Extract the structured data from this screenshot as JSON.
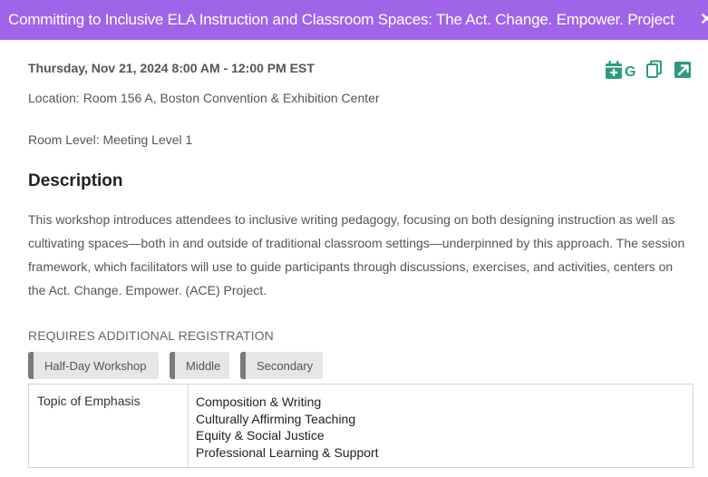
{
  "window": {
    "title": "Committing to Inclusive ELA Instruction and Classroom Spaces: The Act. Change. Empower. Project",
    "close_glyph": "✕"
  },
  "event": {
    "datetime": "Thursday, Nov 21, 2024 8:00 AM - 12:00 PM EST",
    "location": "Location: Room 156 A, Boston Convention & Exhibition Center",
    "room_level": "Room Level: Meeting Level 1"
  },
  "actions": {
    "icons": [
      "calendar-add-icon",
      "google-calendar-icon",
      "copy-icon",
      "external-link-icon"
    ],
    "accent_color": "#2e9a7c"
  },
  "description": {
    "heading": "Description",
    "body": "This workshop introduces attendees to inclusive writing pedagogy, focusing on both designing instruction as well as cultivating spaces—both in and outside of traditional classroom settings—underpinned by this approach. The session framework, which facilitators will use to guide participants through discussions, exercises, and activities, centers on the Act. Change. Empower. (ACE) Project."
  },
  "registration_note": "REQUIRES ADDITIONAL REGISTRATION",
  "tags": [
    "Half-Day Workshop",
    "Middle",
    "Secondary"
  ],
  "details_table": {
    "label": "Topic of Emphasis",
    "values": [
      "Composition & Writing",
      "Culturally Affirming Teaching",
      "Equity & Social Justice",
      "Professional Learning & Support"
    ]
  },
  "colors": {
    "title_bar": "#a064e8",
    "tag_background": "#e6e6e6",
    "tag_accent": "#7a7a7a"
  }
}
